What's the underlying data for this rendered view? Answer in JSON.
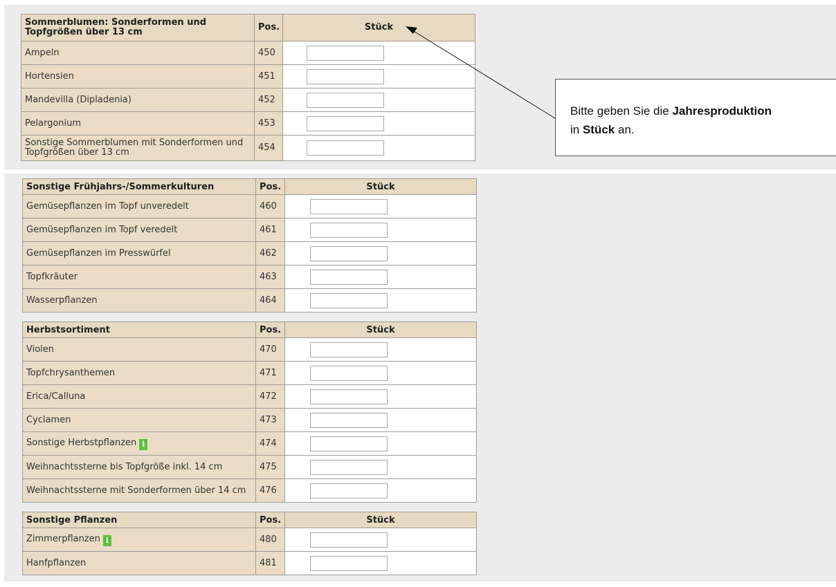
{
  "tables": [
    {
      "title": "Sommerblumen: Sonderformen und Topfgrößen über 13 cm",
      "pos_header": "Pos.",
      "qty_header": "Stück",
      "rows": [
        {
          "label": "Ampeln",
          "pos": "450",
          "value": ""
        },
        {
          "label": "Hortensien",
          "pos": "451",
          "value": ""
        },
        {
          "label": "Mandevilla (Dipladenia)",
          "pos": "452",
          "value": ""
        },
        {
          "label": "Pelargonium",
          "pos": "453",
          "value": ""
        },
        {
          "label": "Sonstige Sommerblumen mit Sonderformen und Topfgrößen über 13 cm",
          "pos": "454",
          "value": ""
        }
      ]
    },
    {
      "title": "Sonstige Frühjahrs-/Sommerkulturen",
      "pos_header": "Pos.",
      "qty_header": "Stück",
      "rows": [
        {
          "label": "Gemüsepflanzen im Topf unveredelt",
          "pos": "460",
          "value": ""
        },
        {
          "label": "Gemüsepflanzen im Topf veredelt",
          "pos": "461",
          "value": ""
        },
        {
          "label": "Gemüsepflanzen im Presswürfel",
          "pos": "462",
          "value": ""
        },
        {
          "label": "Topfkräuter",
          "pos": "463",
          "value": ""
        },
        {
          "label": "Wasserpflanzen",
          "pos": "464",
          "value": ""
        }
      ]
    },
    {
      "title": "Herbstsortiment",
      "pos_header": "Pos.",
      "qty_header": "Stück",
      "rows": [
        {
          "label": "Violen",
          "pos": "470",
          "value": ""
        },
        {
          "label": "Topfchrysanthemen",
          "pos": "471",
          "value": ""
        },
        {
          "label": "Erica/Calluna",
          "pos": "472",
          "value": ""
        },
        {
          "label": "Cyclamen",
          "pos": "473",
          "value": ""
        },
        {
          "label": "Sonstige Herbstpflanzen",
          "pos": "474",
          "value": "",
          "info_icon": "i"
        },
        {
          "label": "Weihnachtssterne bis Topfgröße inkl. 14 cm",
          "pos": "475",
          "value": ""
        },
        {
          "label": "Weihnachtssterne mit Sonderformen über 14 cm",
          "pos": "476",
          "value": ""
        }
      ]
    },
    {
      "title": "Sonstige Pflanzen",
      "pos_header": "Pos.",
      "qty_header": "Stück",
      "rows": [
        {
          "label": "Zimmerpflanzen",
          "pos": "480",
          "value": "",
          "info_icon": "i"
        },
        {
          "label": "Hanfpflanzen",
          "pos": "481",
          "value": ""
        }
      ]
    }
  ],
  "note": {
    "line1_prefix": "Bitte geben Sie die ",
    "line1_bold": "Jahresproduktion",
    "line2_prefix": "in ",
    "line2_bold": "Stück",
    "line2_suffix": " an."
  },
  "colors": {
    "header_bg": "#e8dac2",
    "label_bg": "#eadcc6",
    "panel_bg": "#ececec",
    "info_icon_green": "#5fbf42"
  }
}
